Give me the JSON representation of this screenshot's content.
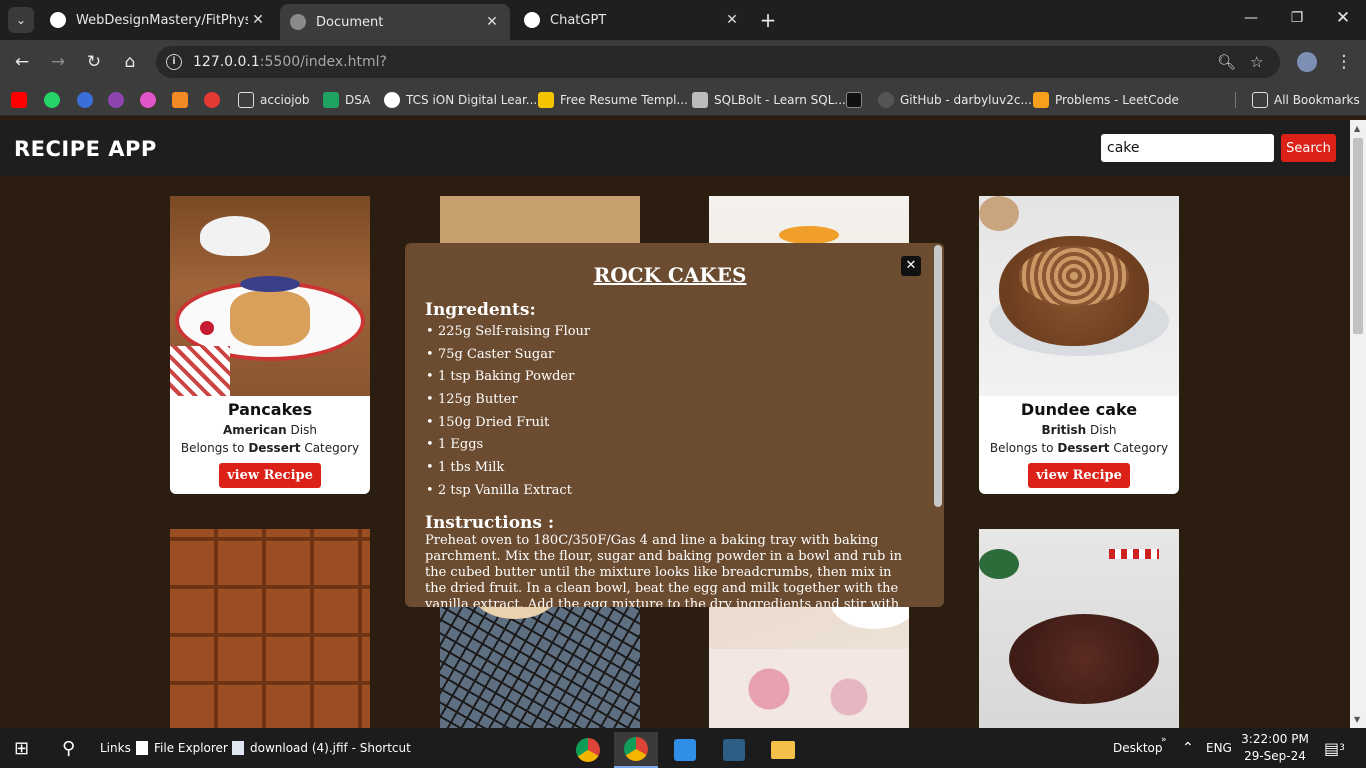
{
  "browser": {
    "tabs": [
      {
        "title": "WebDesignMastery/FitPhysique",
        "active": false
      },
      {
        "title": "Document",
        "active": true
      },
      {
        "title": "ChatGPT",
        "active": false
      }
    ],
    "url_host": "127.0.0.1",
    "url_path": ":5500/index.html?",
    "bookmarks": [
      {
        "label": "",
        "icon": "youtube-icon"
      },
      {
        "label": "",
        "icon": "whatsapp-icon"
      },
      {
        "label": "",
        "icon": "c-icon"
      },
      {
        "label": "",
        "icon": "u-icon"
      },
      {
        "label": "",
        "icon": "color-icon"
      },
      {
        "label": "",
        "icon": "fox-icon"
      },
      {
        "label": "",
        "icon": "tuf-icon"
      },
      {
        "label": "acciojob",
        "icon": "folder-icon"
      },
      {
        "label": "DSA",
        "icon": "sheets-icon"
      },
      {
        "label": "TCS iON Digital Lear...",
        "icon": "tcs-icon"
      },
      {
        "label": "Free Resume Templ...",
        "icon": "resume-icon"
      },
      {
        "label": "SQLBolt - Learn SQL...",
        "icon": "sql-icon"
      },
      {
        "label": "",
        "icon": "m-icon"
      },
      {
        "label": "GitHub - darbyluv2c...",
        "icon": "github-icon"
      },
      {
        "label": "Problems - LeetCode",
        "icon": "leetcode-icon"
      },
      {
        "label": "All Bookmarks",
        "icon": "folder-icon"
      }
    ]
  },
  "app": {
    "title": "RECIPE APP",
    "search_value": "cake",
    "search_button": "Search"
  },
  "cards": [
    {
      "name": "Pancakes",
      "area": "American",
      "area_suffix": "Dish",
      "cat_prefix": "Belongs to",
      "category": "Dessert",
      "cat_suffix": "Category",
      "button": "view Recipe"
    },
    {
      "name": "Dundee cake",
      "area": "British",
      "area_suffix": "Dish",
      "cat_prefix": "Belongs to",
      "category": "Dessert",
      "cat_suffix": "Category",
      "button": "view Recipe"
    }
  ],
  "modal": {
    "title": "ROCK CAKES",
    "ingredients_heading": "Ingredents:",
    "ingredients": [
      "225g Self-raising Flour",
      "75g Caster Sugar",
      "1 tsp Baking Powder",
      "125g Butter",
      "150g Dried Fruit",
      "1 Eggs",
      "1 tbs Milk",
      "2 tsp Vanilla Extract"
    ],
    "instructions_heading": "Instructions :",
    "instructions": "Preheat oven to 180C/350F/Gas 4 and line a baking tray with baking parchment. Mix the flour, sugar and baking powder in a bowl and rub in the cubed butter until the mixture looks like breadcrumbs, then mix in the dried fruit. In a clean bowl, beat the egg and milk together with the vanilla extract. Add the egg mixture to the dry ingredients and stir with"
  },
  "taskbar": {
    "links": "Links",
    "file_explorer": "File Explorer",
    "shortcut": "download (4).jfif - Shortcut",
    "desktop": "Desktop",
    "lang": "ENG",
    "time": "3:22:00 PM",
    "date": "29-Sep-24",
    "notif_count": "3"
  }
}
